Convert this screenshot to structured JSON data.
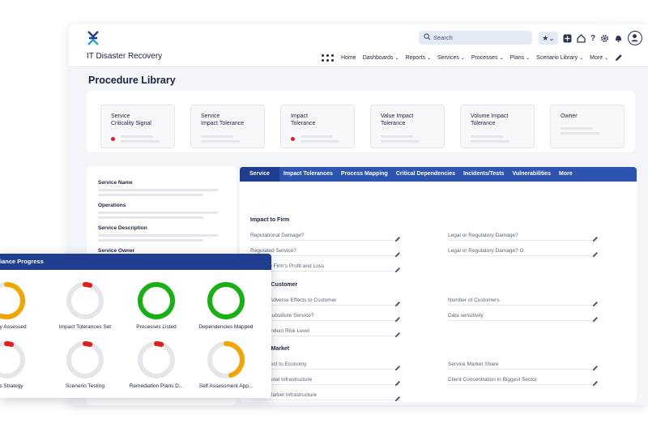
{
  "app": {
    "title": "IT Disaster Recovery",
    "brand_color": "#1f3e8f",
    "accent_color": "#2d55b0"
  },
  "search": {
    "placeholder": "Search",
    "icon": "search-icon"
  },
  "toolbar": {
    "icons": [
      "star-icon",
      "plus-box-icon",
      "home-icon",
      "help-icon",
      "gear-icon",
      "bell-icon",
      "user-avatar-icon"
    ],
    "help_label": "?",
    "star_caret": "⌄"
  },
  "nav": {
    "items": [
      "Home",
      "Dashboards",
      "Reports",
      "Services",
      "Processes",
      "Plans",
      "Scenario Library",
      "More"
    ],
    "chevron": "⌄"
  },
  "page": {
    "title": "Procedure Library"
  },
  "cards": [
    {
      "line1": "Service",
      "line2": "Criticality Signal",
      "status": "red"
    },
    {
      "line1": "Service",
      "line2": "Impact Tolerance",
      "status": ""
    },
    {
      "line1": "Impact",
      "line2": "Tolerance",
      "status": "red"
    },
    {
      "line1": "Value Impact",
      "line2": "Tolerance",
      "status": ""
    },
    {
      "line1": "Volume Impact",
      "line2": "Tolerance",
      "status": ""
    },
    {
      "line1": "Owner",
      "line2": "",
      "status": ""
    }
  ],
  "service_panel": {
    "labels": [
      "Service Name",
      "Operations",
      "Service Description",
      "Service Owner"
    ]
  },
  "tabs": [
    "Service",
    "Impact Tolerances",
    "Process Mapping",
    "Critical Dependencies",
    "Incidents/Tests",
    "Vulnerabilities",
    "More"
  ],
  "sections": {
    "firm": {
      "title": "Impact to Firm",
      "left": [
        "Reputational Damage?",
        "Regulated Service?",
        "Impact to Firm's Profit and Loss"
      ],
      "right": [
        "Legal or Regulatory Damage?",
        "Legal or Regulatory Damage? O"
      ]
    },
    "customer": {
      "title": "to Customer",
      "left": [
        "nt Adverse Effects to Customer",
        "e Substitute Service?",
        "Conduct Risk Level"
      ],
      "right": [
        "Number of Customers",
        "Data sensitivity"
      ]
    },
    "market": {
      "title": "to Market",
      "left": [
        "Effect to Economy",
        "ational Infrastructure",
        "s Market Infrastructure"
      ],
      "right": [
        "Service Market Share",
        "Client Concentration in Biggest Sector"
      ]
    }
  },
  "progress": {
    "title": "iance Progress",
    "items": [
      {
        "label": "iticality Assessed",
        "fraction": 0.55,
        "color": "#f0a500"
      },
      {
        "label": "Impact Tolerances Set",
        "fraction": 0.05,
        "color": "#e11d1d"
      },
      {
        "label": "Processes Listed",
        "fraction": 1.0,
        "color": "#19b014"
      },
      {
        "label": "Dependencies Mapped",
        "fraction": 1.0,
        "color": "#19b014"
      },
      {
        "label": "pRes Strategy",
        "fraction": 0.05,
        "color": "#e11d1d"
      },
      {
        "label": "Scenerio Testing",
        "fraction": 0.05,
        "color": "#e11d1d"
      },
      {
        "label": "Remediation Plans D...",
        "fraction": 0.05,
        "color": "#e11d1d"
      },
      {
        "label": "Self Assessment App...",
        "fraction": 0.45,
        "color": "#f0a500"
      }
    ]
  }
}
